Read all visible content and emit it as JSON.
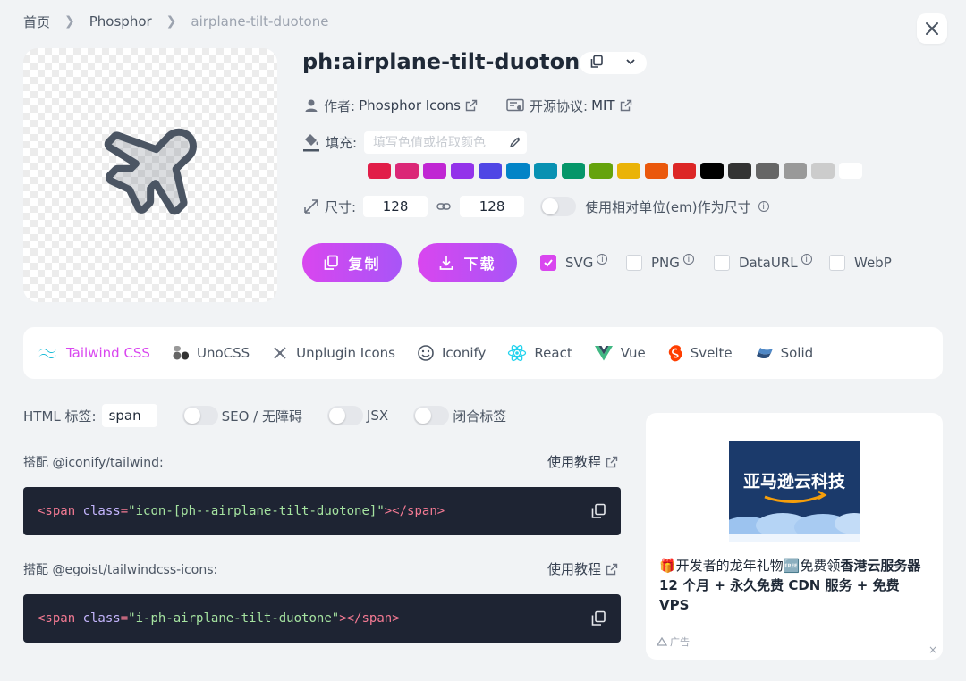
{
  "breadcrumb": {
    "home": "首页",
    "collection": "Phosphor",
    "current": "airplane-tilt-duotone"
  },
  "icon": {
    "title": "ph:airplane-tilt-duotone",
    "author_label": "作者:",
    "author": "Phosphor Icons",
    "license_label": "开源协议:",
    "license": "MIT"
  },
  "fill": {
    "label": "填充:",
    "placeholder": "填写色值或拾取颜色",
    "swatches": [
      "#e11d48",
      "#db2777",
      "#c026d3",
      "#9333ea",
      "#4f46e5",
      "#0284c7",
      "#0891b2",
      "#059669",
      "#65a30d",
      "#eab308",
      "#ea580c",
      "#dc2626",
      "#000000",
      "#333333",
      "#666666",
      "#999999",
      "#cccccc",
      "#ffffff"
    ]
  },
  "size": {
    "label": "尺寸:",
    "width": "128",
    "height": "128",
    "relative_label": "使用相对单位(em)作为尺寸"
  },
  "actions": {
    "copy": "复制",
    "download": "下载"
  },
  "formats": [
    {
      "label": "SVG",
      "checked": true
    },
    {
      "label": "PNG",
      "checked": false
    },
    {
      "label": "DataURL",
      "checked": false
    },
    {
      "label": "WebP",
      "checked": false
    }
  ],
  "tabs": [
    "Tailwind CSS",
    "UnoCSS",
    "Unplugin Icons",
    "Iconify",
    "React",
    "Vue",
    "Svelte",
    "Solid"
  ],
  "html_options": {
    "tag_label": "HTML 标签:",
    "tag_value": "span",
    "seo_label": "SEO / 无障碍",
    "jsx_label": "JSX",
    "closed_label": "闭合标签"
  },
  "snippets": [
    {
      "label": "搭配 @iconify/tailwind:",
      "tutorial": "使用教程",
      "code_open": "<span ",
      "code_attr": "class",
      "code_eq": "=",
      "code_str": "\"icon-[ph--airplane-tilt-duotone]\"",
      "code_close": "></span>"
    },
    {
      "label": "搭配 @egoist/tailwindcss-icons:",
      "tutorial": "使用教程",
      "code_open": "<span ",
      "code_attr": "class",
      "code_eq": "=",
      "code_str": "\"i-ph-airplane-tilt-duotone\"",
      "code_close": "></span>"
    }
  ],
  "ad": {
    "image_text": "亚马逊云科技",
    "line1_a": "🎁开发者的龙年礼物🆓免费领",
    "line1_b": "香港云服务器 12 个月 + 永久免费 CDN 服务 + 免费 VPS",
    "footer": "广告",
    "close": "×"
  }
}
